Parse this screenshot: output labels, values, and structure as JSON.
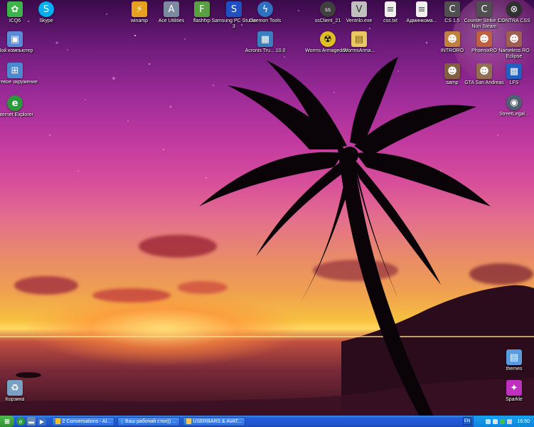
{
  "desktop_icons": [
    {
      "label": "ICQ6",
      "icon": "icq-icon",
      "color": "#3bb54a",
      "glyph": "✿"
    },
    {
      "label": "Skype",
      "icon": "skype-icon",
      "color": "#00aff0",
      "glyph": "S"
    },
    {
      "label": "winamp",
      "icon": "winamp-icon",
      "color": "#e8a020",
      "glyph": "⚡"
    },
    {
      "label": "Ace Utilities",
      "icon": "ace-utilities-icon",
      "color": "#7a8aa0",
      "glyph": "A"
    },
    {
      "label": "flashfxp",
      "icon": "flashfxp-icon",
      "color": "#5aa040",
      "glyph": "F"
    },
    {
      "label": "Samsung PC Studio 3",
      "icon": "samsung-pc-studio-icon",
      "color": "#2050c0",
      "glyph": "S"
    },
    {
      "label": "Daemon Tools",
      "icon": "daemon-tools-icon",
      "color": "#3070c0",
      "glyph": "ϟ"
    },
    {
      "label": "ssClient_21",
      "icon": "ssclient-icon",
      "color": "#404040",
      "glyph": "ss"
    },
    {
      "label": "Ventrilo.exe",
      "icon": "ventrilo-icon",
      "color": "#c0c0c0",
      "glyph": "V"
    },
    {
      "label": "css.txt",
      "icon": "text-file-icon",
      "color": "#f0f0f0",
      "glyph": "≡"
    },
    {
      "label": "Админкома...",
      "icon": "text-file-icon",
      "color": "#f0f0f0",
      "glyph": "≡"
    },
    {
      "label": "CS 1.5",
      "icon": "counter-strike-icon",
      "color": "#505050",
      "glyph": "C"
    },
    {
      "label": "Counter Strike 1.6 Non Steam",
      "icon": "counter-strike-icon",
      "color": "#505050",
      "glyph": "C"
    },
    {
      "label": "CONTRA CSS",
      "icon": "contra-css-icon",
      "color": "#303030",
      "glyph": "⊗"
    },
    {
      "label": "Мой компьютер",
      "icon": "my-computer-icon",
      "color": "#5a8ad8",
      "glyph": "▣"
    },
    {
      "label": "Acronis Tru... 10.0",
      "icon": "acronis-icon",
      "color": "#3a80c0",
      "glyph": "▦"
    },
    {
      "label": "Worms Armageddon",
      "icon": "worms-icon",
      "color": "#e0c020",
      "glyph": "☢"
    },
    {
      "label": "WormsArma...",
      "icon": "folder-icon",
      "color": "#e8c860",
      "glyph": "▤"
    },
    {
      "label": "INTRORO",
      "icon": "introro-icon",
      "color": "#c08040",
      "glyph": "☻"
    },
    {
      "label": "PhoenixRO",
      "icon": "phoenixro-icon",
      "color": "#c06040",
      "glyph": "☻"
    },
    {
      "label": "Nameless RO Eclipse",
      "icon": "nameless-ro-icon",
      "color": "#a06050",
      "glyph": "☻"
    },
    {
      "label": "Сетевое окружение",
      "icon": "network-icon",
      "color": "#4a8ad0",
      "glyph": "⊞"
    },
    {
      "label": "samp",
      "icon": "samp-icon",
      "color": "#806040",
      "glyph": "☻"
    },
    {
      "label": "GTA San Andreas",
      "icon": "gta-icon",
      "color": "#907050",
      "glyph": "☻"
    },
    {
      "label": "LFS",
      "icon": "lfs-icon",
      "color": "#2060c0",
      "glyph": "▩"
    },
    {
      "label": "Internet Explorer",
      "icon": "internet-explorer-icon",
      "color": "#2a9a3a",
      "glyph": "e"
    },
    {
      "label": "StreetLegal...",
      "icon": "streetlegal-icon",
      "color": "#506070",
      "glyph": "◉"
    },
    {
      "label": "themes",
      "icon": "folder-icon",
      "color": "#5a9ae0",
      "glyph": "▤"
    },
    {
      "label": "Корзина",
      "icon": "recycle-bin-icon",
      "color": "#7aa0c8",
      "glyph": "♻"
    },
    {
      "label": "Sparkle",
      "icon": "sparkle-icon",
      "color": "#c030c0",
      "glyph": "✦"
    }
  ],
  "taskbar": {
    "start_label": "",
    "quick_launch": [
      {
        "icon": "internet-explorer-icon",
        "color": "#2a9a3a",
        "glyph": "e"
      },
      {
        "icon": "show-desktop-icon",
        "color": "#6a8ab8",
        "glyph": "▬"
      },
      {
        "icon": "media-player-icon",
        "color": "#3a70c0",
        "glyph": "▶"
      }
    ],
    "tasks": [
      {
        "label": "2 Conversations - Al...",
        "icon": "chat-icon",
        "color": "#e8c030"
      },
      {
        "label": "Ваш рабочий стол)) ...",
        "icon": "internet-explorer-icon",
        "color": "#4aa0e0"
      },
      {
        "label": "USERBARS & AVAT...",
        "icon": "folder-icon",
        "color": "#e8c860"
      }
    ],
    "language": "EN",
    "tray_icons": [
      {
        "icon": "network-tray-icon",
        "color": "#c0e0ff"
      },
      {
        "icon": "volume-tray-icon",
        "color": "#e0e0e0"
      },
      {
        "icon": "antivirus-tray-icon",
        "color": "#40c040"
      },
      {
        "icon": "safely-remove-tray-icon",
        "color": "#d0d0d0"
      }
    ],
    "clock": "16:50"
  }
}
